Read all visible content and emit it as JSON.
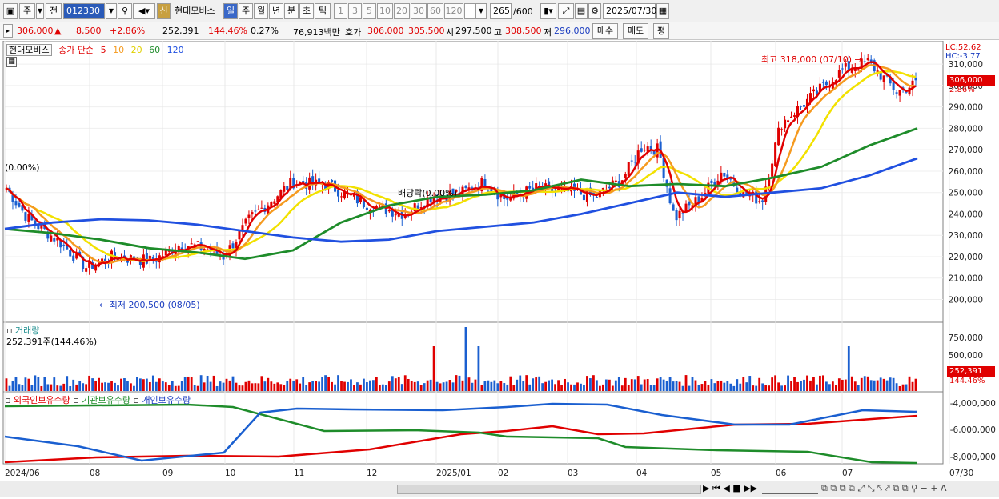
{
  "toolbar": {
    "type_label": "주",
    "prev_label": "전",
    "code": "012330",
    "shin_label": "신",
    "stock_name": "현대모비스",
    "periods": [
      "일",
      "주",
      "월",
      "년",
      "분",
      "초",
      "틱"
    ],
    "numbers": [
      "1",
      "3",
      "5",
      "10",
      "20",
      "30",
      "60",
      "120"
    ],
    "count": "265",
    "count_total": "/600",
    "date": "2025/07/30"
  },
  "quote": {
    "price": "306,000",
    "arrow": "▲",
    "change": "8,500",
    "change_pct": "+2.86%",
    "volume": "252,391",
    "volume_pct": "144.46%",
    "turnover_pct": "0.27%",
    "amount": "76,913백만",
    "hoga_label": "호가",
    "ask": "306,000",
    "bid": "305,500",
    "open_label": "시",
    "open": "297,500",
    "high_label": "고",
    "high": "308,500",
    "low_label": "저",
    "low": "296,000",
    "buy_label": "매수",
    "sell_label": "매도",
    "avg_label": "평"
  },
  "price_pane": {
    "stock_tag": "현대모비스",
    "legend_prefix": "종가 단순",
    "ma_labels": [
      "5",
      "10",
      "20",
      "60",
      "120"
    ],
    "lc": "LC:52.62",
    "hc": "HC:-3.77",
    "high_annotation": "최고 318,000 (07/10)",
    "low_annotation": "최저 200,500 (08/05)",
    "zero_annotation": "(0.00%)",
    "dividend_annotation": "배당락(0.00%)",
    "last_price_tag": "306,000",
    "last_pct_tag": "2.86%",
    "y_ticks": [
      "310,000",
      "300,000",
      "290,000",
      "280,000",
      "270,000",
      "260,000",
      "250,000",
      "240,000",
      "230,000",
      "220,000",
      "210,000",
      "200,000"
    ]
  },
  "volume_pane": {
    "title": "거래량",
    "info": "252,391주(144.46%)",
    "y_ticks": [
      "750,000",
      "500,000",
      "250,000"
    ],
    "last_tag": "252,391",
    "last_pct": "144.46%"
  },
  "holding_pane": {
    "legend": [
      "외국인보유수량",
      "기관보유수량",
      "개인보유수량"
    ],
    "y_ticks": [
      "-4,000,000",
      "-6,000,000",
      "-8,000,000"
    ]
  },
  "x_axis": [
    "2024/06",
    "08",
    "09",
    "10",
    "11",
    "12",
    "2025/01",
    "02",
    "03",
    "04",
    "05",
    "06",
    "07",
    "07/30"
  ],
  "colors": {
    "ma5": "#e00000",
    "ma10": "#f59a1f",
    "ma20": "#f2e100",
    "ma60": "#1e8c2a",
    "ma120": "#2050e0",
    "up": "#e00000",
    "down": "#1a5fd0"
  },
  "chart_data": [
    {
      "type": "line",
      "title": "",
      "ylim": [
        195000,
        320000
      ],
      "series": [
        {
          "name": "120",
          "values": [
            233000,
            236000,
            237500,
            237000,
            235000,
            232000,
            229000,
            227000,
            228000,
            232000,
            234000,
            236000,
            240000,
            245000,
            250000,
            248000,
            250000,
            252000,
            258000,
            266000
          ]
        },
        {
          "name": "60",
          "values": [
            233000,
            231000,
            228000,
            224000,
            222000,
            219000,
            223000,
            236000,
            244000,
            248000,
            249000,
            251000,
            256000,
            253000,
            254000,
            253000,
            257000,
            262000,
            272000,
            280000
          ]
        }
      ],
      "x": [
        "2024/06",
        "07",
        "08",
        "08",
        "09",
        "10",
        "10",
        "11",
        "12",
        "2025/01",
        "02",
        "03",
        "04",
        "04",
        "05",
        "06",
        "06",
        "07",
        "07",
        "07/30"
      ]
    }
  ]
}
